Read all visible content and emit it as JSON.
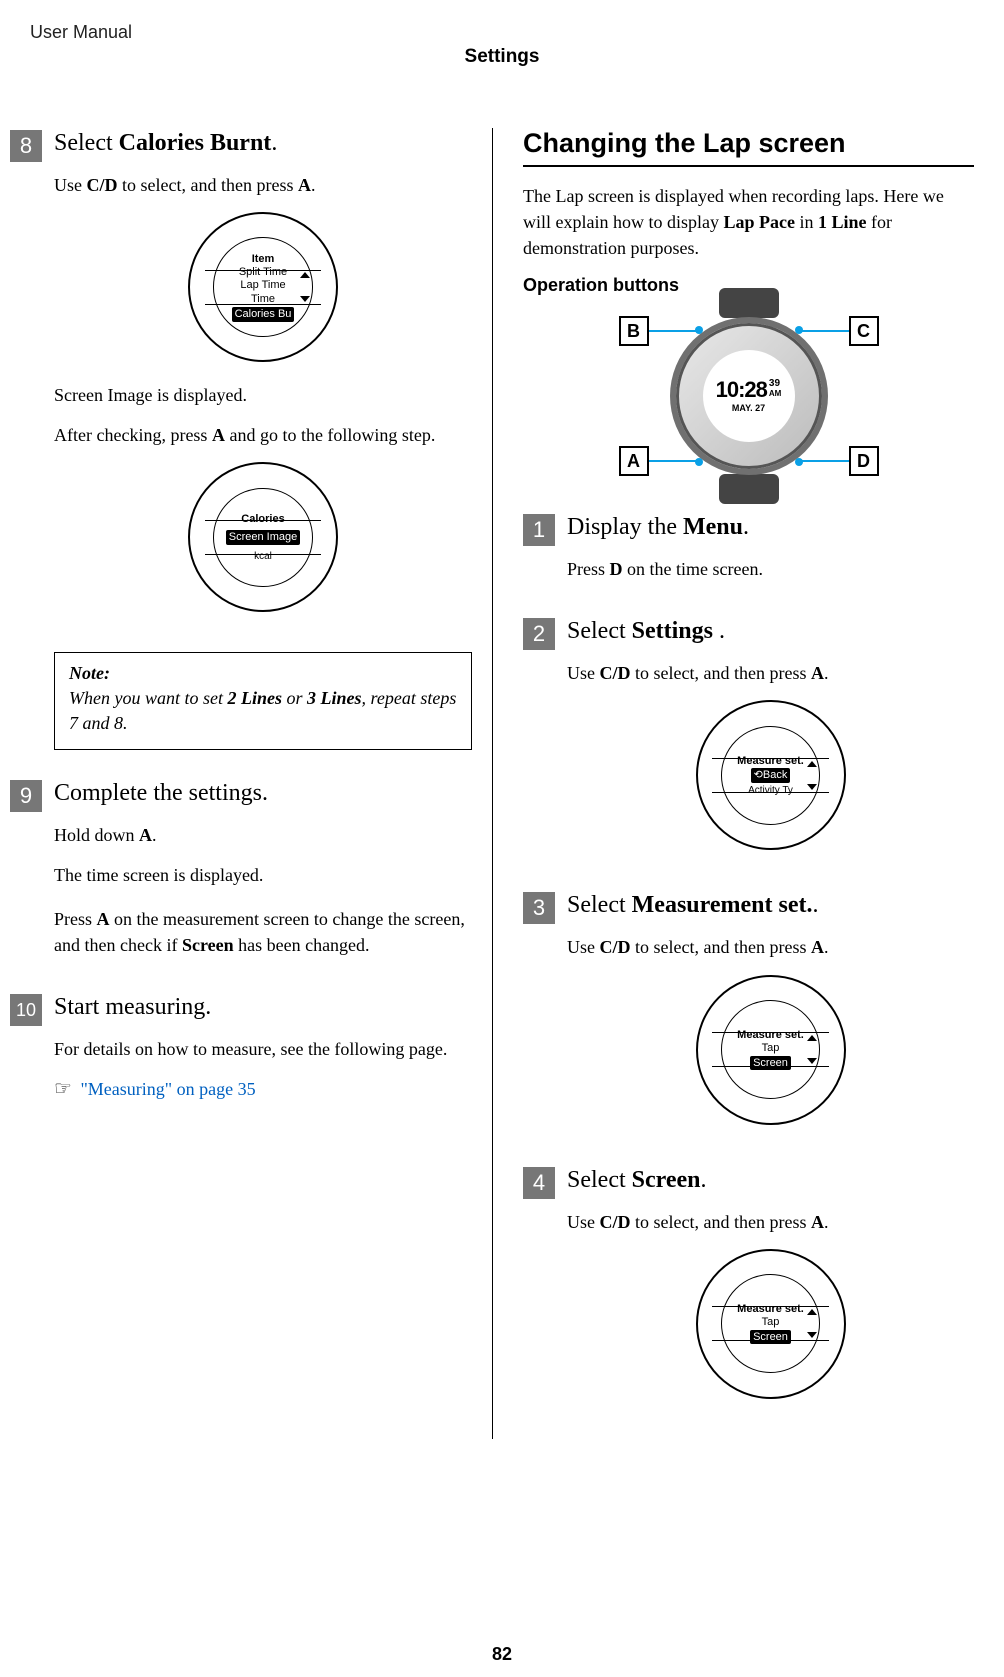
{
  "header": {
    "left": "User Manual",
    "center": "Settings"
  },
  "page_number": "82",
  "left_column": {
    "step8": {
      "num": "8",
      "title_prefix": "Select ",
      "title_bold": "Calories Burnt",
      "title_suffix": ".",
      "instr_a": "Use ",
      "instr_b": "C/D",
      "instr_c": " to select, and then press ",
      "instr_d": "A",
      "instr_e": ".",
      "screen1_title": "Item",
      "screen1_l1": "Split Time",
      "screen1_l2": "Lap Time",
      "screen1_l3": "Time",
      "screen1_hl": "Calories Bu",
      "p2": "Screen Image is displayed.",
      "p3a": "After checking, press ",
      "p3b": "A",
      "p3c": " and go to the following step.",
      "screen2_title": "Calories",
      "screen2_hl": "Screen Image",
      "screen2_sub": "kcal"
    },
    "note": {
      "title": "Note:",
      "body_a": "When you want to set ",
      "body_b": "2 Lines",
      "body_c": " or ",
      "body_d": "3 Lines",
      "body_e": ", repeat steps 7 and 8."
    },
    "step9": {
      "num": "9",
      "title": "Complete the settings.",
      "p1a": "Hold down ",
      "p1b": "A",
      "p1c": ".",
      "p2": "The time screen is displayed.",
      "p3a": "Press ",
      "p3b": "A",
      "p3c": " on the measurement screen to change the screen, and then check if ",
      "p3d": "Screen",
      "p3e": " has been changed."
    },
    "step10": {
      "num": "10",
      "title": "Start measuring.",
      "p1": "For details on how to measure, see the following page.",
      "ref_icon": "☞",
      "ref_text": "\"Measuring\" on page 35"
    }
  },
  "right_column": {
    "heading": "Changing the Lap screen",
    "para_a": "The Lap screen is displayed when recording laps. Here we will explain how to display ",
    "para_b": "Lap Pace",
    "para_c": " in ",
    "para_d": "1 Line",
    "para_e": " for demonstration purposes.",
    "sub_heading": "Operation buttons",
    "op_labels": {
      "A": "A",
      "B": "B",
      "C": "C",
      "D": "D"
    },
    "op_time_main": "10:28",
    "op_time_sec": "39",
    "op_time_ampm": "AM",
    "op_date": "MAY. 27",
    "step1": {
      "num": "1",
      "title_prefix": "Display the ",
      "title_bold": "Menu",
      "title_suffix": ".",
      "p_a": "Press ",
      "p_b": "D",
      "p_c": " on the time screen."
    },
    "step2": {
      "num": "2",
      "title_prefix": "Select ",
      "title_bold": "Settings ",
      "title_suffix": ".",
      "instr_a": "Use ",
      "instr_b": "C/D",
      "instr_c": " to select, and then press ",
      "instr_d": "A",
      "instr_e": ".",
      "screen_title": "Measure set.",
      "screen_hl": "⟲Back",
      "screen_sub": "Activity Ty"
    },
    "step3": {
      "num": "3",
      "title_prefix": "Select ",
      "title_bold": "Measurement set.",
      "title_suffix": ".",
      "instr_a": "Use ",
      "instr_b": "C/D",
      "instr_c": " to select, and then press ",
      "instr_d": "A",
      "instr_e": ".",
      "screen_title": "Measure set.",
      "screen_l1": "Tap",
      "screen_hl": "Screen"
    },
    "step4": {
      "num": "4",
      "title_prefix": "Select ",
      "title_bold": "Screen",
      "title_suffix": ".",
      "instr_a": "Use ",
      "instr_b": "C/D",
      "instr_c": " to select, and then press ",
      "instr_d": "A",
      "instr_e": ".",
      "screen_title": "Measure set.",
      "screen_l1": "Tap",
      "screen_hl": "Screen"
    }
  }
}
